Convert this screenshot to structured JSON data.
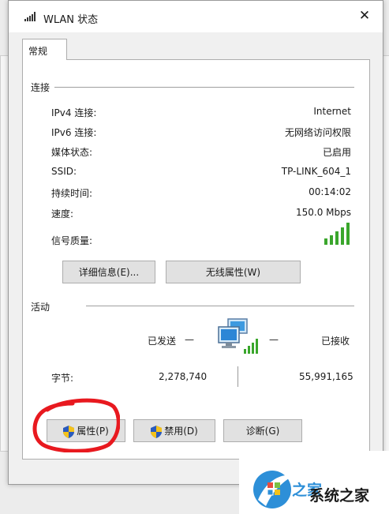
{
  "window": {
    "title": "WLAN 状态",
    "close_label": "✕"
  },
  "tabs": [
    {
      "label": "常规"
    }
  ],
  "connection": {
    "group_label": "连接",
    "rows": [
      {
        "label": "IPv4 连接:",
        "value": "Internet"
      },
      {
        "label": "IPv6 连接:",
        "value": "无网络访问权限"
      },
      {
        "label": "媒体状态:",
        "value": "已启用"
      },
      {
        "label": "SSID:",
        "value": "TP-LINK_604_1"
      },
      {
        "label": "持续时间:",
        "value": "00:14:02"
      },
      {
        "label": "速度:",
        "value": "150.0 Mbps"
      }
    ],
    "signal_label": "信号质量:",
    "signal_level": "5/5",
    "buttons": {
      "details": "详细信息(E)...",
      "wireless": "无线属性(W)"
    }
  },
  "activity": {
    "group_label": "活动",
    "sent_label": "已发送",
    "received_label": "已接收",
    "bytes_label": "字节:",
    "bytes_sent": "2,278,740",
    "bytes_received": "55,991,165",
    "dash": "—"
  },
  "actions": {
    "properties": "属性(P)",
    "disable": "禁用(D)",
    "diagnose": "诊断(G)"
  },
  "watermark": {
    "text": "系统之家",
    "partial": "Win 10 系统之家"
  },
  "colors": {
    "signal": "#3aa62c",
    "annotation": "#e8191f",
    "shield_blue": "#2a5bbd",
    "shield_yellow": "#f4c21b"
  }
}
